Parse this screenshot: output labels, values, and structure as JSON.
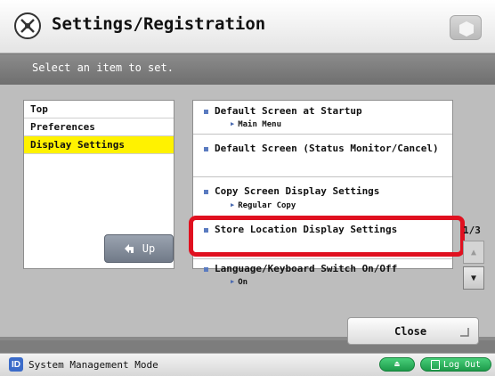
{
  "header": {
    "title": "Settings/Registration"
  },
  "subheader": {
    "instruction": "Select an item to set."
  },
  "categories": [
    {
      "label": "Top",
      "selected": false
    },
    {
      "label": "Preferences",
      "selected": false
    },
    {
      "label": "Display Settings",
      "selected": true
    }
  ],
  "up_button": {
    "label": "Up",
    "icon": "up-arrow-icon"
  },
  "settings_list": [
    {
      "label": "Default Screen at Startup",
      "value": "Main Menu"
    },
    {
      "label": "Default Screen (Status Monitor/Cancel)",
      "value": ""
    },
    {
      "label": "Copy Screen Display Settings",
      "value": "Regular Copy"
    },
    {
      "label": "Store Location Display Settings",
      "value": ""
    },
    {
      "label": "Language/Keyboard Switch On/Off",
      "value": "On"
    }
  ],
  "pagination": {
    "indicator": "1/3"
  },
  "close_button": {
    "label": "Close"
  },
  "footer": {
    "mode_badge": "ID",
    "mode_text": "System Management Mode",
    "logout_label": "Log Out"
  },
  "colors": {
    "selected": "#fff200",
    "highlight": "#e0101f",
    "accent_green": "#1d9a4a"
  }
}
